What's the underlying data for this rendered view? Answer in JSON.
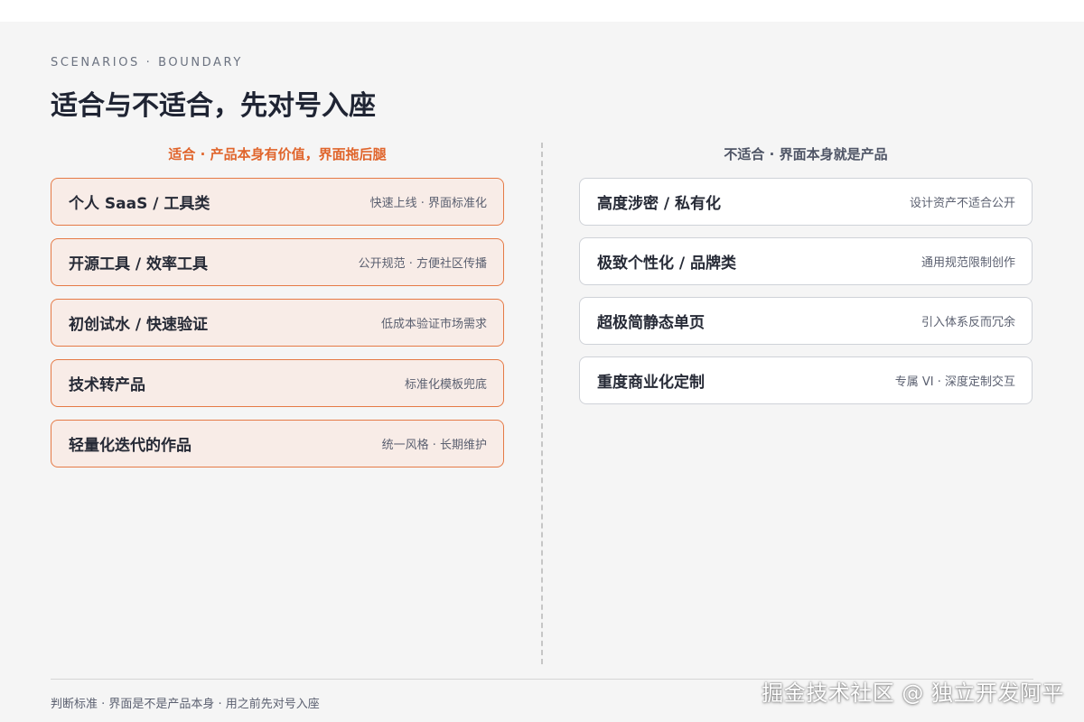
{
  "kicker": "SCENARIOS · BOUNDARY",
  "title": "适合与不适合，先对号入座",
  "colors": {
    "accent": "#e0652c",
    "card_border_suitable": "#e57a46",
    "card_bg_suitable": "#f8ece7",
    "text_dark": "#1f2433",
    "text_muted": "#5b6070"
  },
  "suitable": {
    "heading": "适合 · 产品本身有价值，界面拖后腿",
    "items": [
      {
        "name": "个人 SaaS / 工具类",
        "note": "快速上线 · 界面标准化"
      },
      {
        "name": "开源工具 / 效率工具",
        "note": "公开规范 · 方便社区传播"
      },
      {
        "name": "初创试水 / 快速验证",
        "note": "低成本验证市场需求"
      },
      {
        "name": "技术转产品",
        "note": "标准化模板兜底"
      },
      {
        "name": "轻量化迭代的作品",
        "note": "统一风格 · 长期维护"
      }
    ]
  },
  "unsuitable": {
    "heading": "不适合 · 界面本身就是产品",
    "items": [
      {
        "name": "高度涉密 / 私有化",
        "note": "设计资产不适合公开"
      },
      {
        "name": "极致个性化 / 品牌类",
        "note": "通用规范限制创作"
      },
      {
        "name": "超极简静态单页",
        "note": "引入体系反而冗余"
      },
      {
        "name": "重度商业化定制",
        "note": "专属 VI · 深度定制交互"
      }
    ]
  },
  "footer": "判断标准 · 界面是不是产品本身 · 用之前先对号入座",
  "watermark": "掘金技术社区 @ 独立开发阿平"
}
